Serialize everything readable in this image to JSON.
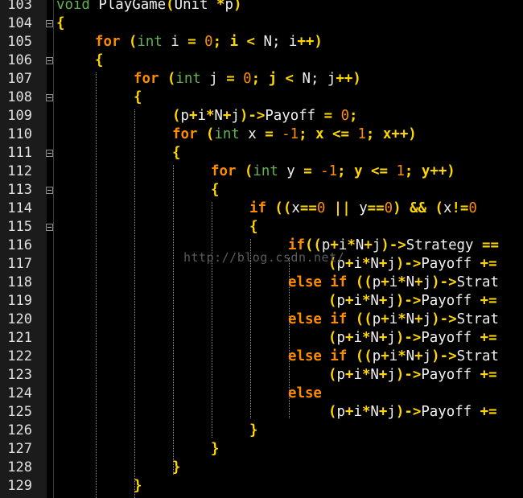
{
  "watermark": "http://blog.csdn.net/",
  "line_numbers": [
    "103",
    "104",
    "105",
    "106",
    "107",
    "108",
    "109",
    "110",
    "111",
    "112",
    "113",
    "114",
    "115",
    "116",
    "117",
    "118",
    "119",
    "120",
    "121",
    "122",
    "123",
    "124",
    "125",
    "126",
    "127",
    "128",
    "129"
  ],
  "code": {
    "l103": {
      "a": "void ",
      "b": "PlayGame",
      "c": "(",
      "d": "Unit ",
      "e": "*",
      "f": "p",
      "g": ")"
    },
    "l104": {
      "a": "{"
    },
    "l105": {
      "a": "for ",
      "b": "(",
      "c": "int ",
      "d": "i ",
      "e": "= ",
      "f": "0",
      "g": "; i ",
      "h": "< ",
      "i": "N; i",
      "j": "++",
      "k": ")"
    },
    "l106": {
      "a": "{"
    },
    "l107": {
      "a": "for ",
      "b": "(",
      "c": "int ",
      "d": "j ",
      "e": "= ",
      "f": "0",
      "g": "; j ",
      "h": "< ",
      "i": "N; j",
      "j": "++",
      "k": ")"
    },
    "l108": {
      "a": "{"
    },
    "l109": {
      "a": "(",
      "b": "p",
      "c": "+",
      "d": "i",
      "e": "*",
      "f": "N",
      "g": "+",
      "h": "j",
      ")": ")",
      "i": "->",
      "j": "Payoff ",
      "k": "= ",
      "l": "0",
      "m": ";"
    },
    "l110": {
      "a": "for ",
      "b": "(",
      "c": "int ",
      "d": "x ",
      "e": "= ",
      "f": "-1",
      "g": "; x ",
      "h": "<= ",
      "i": "1",
      "j": "; x",
      "k": "++",
      "l": ")"
    },
    "l111": {
      "a": "{"
    },
    "l112": {
      "a": "for ",
      "b": "(",
      "c": "int ",
      "d": "y ",
      "e": "= ",
      "f": "-1",
      "g": "; y ",
      "h": "<= ",
      "i": "1",
      "j": "; y",
      "k": "++",
      "l": ")"
    },
    "l113": {
      "a": "{"
    },
    "l114": {
      "a": "if ",
      "b": "((",
      "c": "x",
      "d": "==",
      "e": "0 ",
      "f": "|| ",
      "g": "y",
      "h": "==",
      "i": "0",
      "j": ") ",
      "k": "&& ",
      "l": "(",
      "m": "x",
      "n": "!=",
      "o": "0"
    },
    "l115": {
      "a": "{"
    },
    "l116": {
      "a": "if",
      "b": "((",
      "c": "p",
      "d": "+",
      "e": "i",
      "f": "*",
      "g": "N",
      "h": "+",
      "i": "j",
      "j": ")",
      "k": "->",
      "l": "Strategy ",
      "m": "=="
    },
    "l117": {
      "a": "(",
      "b": "p",
      "c": "+",
      "d": "i",
      "e": "*",
      "f": "N",
      "g": "+",
      "h": "j",
      "i": ")",
      "j": "->",
      "k": "Payoff ",
      "l": "+="
    },
    "l118": {
      "a": "else ",
      "b": "if ",
      "c": "((",
      "d": "p",
      "e": "+",
      "f": "i",
      "g": "*",
      "h": "N",
      "i": "+",
      "j": "j",
      "k": ")",
      "l": "->",
      "m": "Strat"
    },
    "l119": {
      "a": "(",
      "b": "p",
      "c": "+",
      "d": "i",
      "e": "*",
      "f": "N",
      "g": "+",
      "h": "j",
      "i": ")",
      "j": "->",
      "k": "Payoff ",
      "l": "+="
    },
    "l120": {
      "a": "else ",
      "b": "if ",
      "c": "((",
      "d": "p",
      "e": "+",
      "f": "i",
      "g": "*",
      "h": "N",
      "i": "+",
      "j": "j",
      "k": ")",
      "l": "->",
      "m": "Strat"
    },
    "l121": {
      "a": "(",
      "b": "p",
      "c": "+",
      "d": "i",
      "e": "*",
      "f": "N",
      "g": "+",
      "h": "j",
      "i": ")",
      "j": "->",
      "k": "Payoff ",
      "l": "+="
    },
    "l122": {
      "a": "else ",
      "b": "if ",
      "c": "((",
      "d": "p",
      "e": "+",
      "f": "i",
      "g": "*",
      "h": "N",
      "i": "+",
      "j": "j",
      "k": ")",
      "l": "->",
      "m": "Strat"
    },
    "l123": {
      "a": "(",
      "b": "p",
      "c": "+",
      "d": "i",
      "e": "*",
      "f": "N",
      "g": "+",
      "h": "j",
      "i": ")",
      "j": "->",
      "k": "Payoff ",
      "l": "+="
    },
    "l124": {
      "a": "else"
    },
    "l125": {
      "a": "(",
      "b": "p",
      "c": "+",
      "d": "i",
      "e": "*",
      "f": "N",
      "g": "+",
      "h": "j",
      "i": ")",
      "j": "->",
      "k": "Payoff ",
      "l": "+="
    },
    "l126": {
      "a": "}"
    },
    "l127": {
      "a": "}"
    },
    "l128": {
      "a": "}"
    },
    "l129": {
      "a": "}"
    }
  }
}
